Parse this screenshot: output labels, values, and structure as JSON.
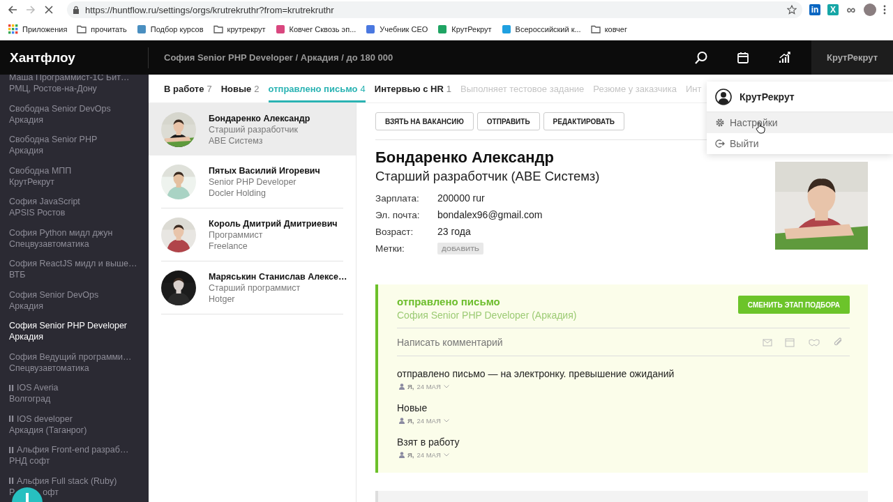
{
  "browser": {
    "url": "https://huntflow.ru/settings/orgs/krutrekruthr?from=krutrekruthr",
    "extensions": [
      {
        "kind": "linkedin",
        "glyph": "in"
      },
      {
        "kind": "x",
        "glyph": "X"
      },
      {
        "kind": "infinity",
        "glyph": "∞"
      },
      {
        "kind": "avatar"
      }
    ],
    "bookmarks": [
      {
        "kind": "apps",
        "label": "Приложения"
      },
      {
        "kind": "folder",
        "label": "прочитать"
      },
      {
        "kind": "site",
        "label": "Подбор курсов",
        "color": "#4a8fc0"
      },
      {
        "kind": "folder",
        "label": "крутрекрут"
      },
      {
        "kind": "site",
        "label": "Ковчег Сквозь эп...",
        "color": "#d9477f"
      },
      {
        "kind": "site",
        "label": "Учебник CEO",
        "color": "#4a78e0"
      },
      {
        "kind": "site",
        "label": "КрутРекрут",
        "color": "#1fa463"
      },
      {
        "kind": "site",
        "label": "Всероссийский к...",
        "color": "#1fa0e0"
      },
      {
        "kind": "folder",
        "label": "ковчег"
      }
    ]
  },
  "header": {
    "logo": "Хантфлоу",
    "breadcrumb": "София Senior PHP Developer / Аркадия / до 180 000",
    "account": "КрутРекрут"
  },
  "sidebar": {
    "items": [
      {
        "title": "Маша Программист-1С Бит…",
        "sub": "РМЦ, Ростов-на-Дону",
        "selected": false,
        "paused": false
      },
      {
        "title": "Свободна Senior DevOps",
        "sub": "Аркадия",
        "selected": false,
        "paused": false
      },
      {
        "title": "Свободна Senior PHP",
        "sub": "Аркадия",
        "selected": false,
        "paused": false
      },
      {
        "title": "Свободна МПП",
        "sub": "КрутРекрут",
        "selected": false,
        "paused": false
      },
      {
        "title": "София JavaScript",
        "sub": "APSIS Ростов",
        "selected": false,
        "paused": false
      },
      {
        "title": "София Python мидл джун",
        "sub": "Спецвузавтоматика",
        "selected": false,
        "paused": false
      },
      {
        "title": "София ReactJS мидл и выше…",
        "sub": "ВТБ",
        "selected": false,
        "paused": false
      },
      {
        "title": "София Senior DevOps",
        "sub": "Аркадия",
        "selected": false,
        "paused": false
      },
      {
        "title": "София Senior PHP Developer",
        "sub": "Аркадия",
        "selected": true,
        "paused": false
      },
      {
        "title": "София Ведущий программи…",
        "sub": "Спецвузавтоматика",
        "selected": false,
        "paused": false
      },
      {
        "title": "IOS Averia",
        "sub": "Волгоград",
        "selected": false,
        "paused": true
      },
      {
        "title": "IOS developer",
        "sub": "Аркадия (Таганрог)",
        "selected": false,
        "paused": true
      },
      {
        "title": "Альфия Front-end разраб…",
        "sub": "РНД софт",
        "selected": false,
        "paused": true
      },
      {
        "title": "Альфия Full stack (Ruby)",
        "sub_parts": [
          "Р",
          "офт"
        ],
        "selected": false,
        "paused": true
      }
    ]
  },
  "tabs": [
    {
      "label": "В работе",
      "count": "7",
      "selected": false,
      "muted": false
    },
    {
      "label": "Новые",
      "count": "2",
      "selected": false,
      "muted": false
    },
    {
      "label": "отправлено письмо",
      "count": "4",
      "selected": true,
      "muted": false
    },
    {
      "label": "Интервью с HR",
      "count": "1",
      "selected": false,
      "muted": false
    },
    {
      "label": "Выполняет тестовое задание",
      "selected": false,
      "muted": true
    },
    {
      "label": "Резюме у заказчика",
      "selected": false,
      "muted": true
    },
    {
      "label": "Инт",
      "selected": false,
      "muted": true
    }
  ],
  "account_menu": {
    "title": "КрутРекрут",
    "items": [
      {
        "kind": "settings",
        "label": "Настройки",
        "selected": true
      },
      {
        "kind": "logout",
        "label": "Выйти",
        "selected": false
      }
    ]
  },
  "candidates": [
    {
      "name": "Бондаренко Александр",
      "position": "Старший разработчик",
      "company": "ABE Системз",
      "selected": true
    },
    {
      "name": "Пятых Василий Игоревич",
      "position": "Senior PHP Developer",
      "company": "Docler Holding",
      "selected": false
    },
    {
      "name": "Король Дмитрий Дмитриевич",
      "position": "Программист",
      "company": "Freelance",
      "selected": false
    },
    {
      "name": "Маряськин Станислав Алексе…",
      "position": "Старший программист",
      "company": "Hotger",
      "selected": false
    }
  ],
  "profile": {
    "buttons": [
      "ВЗЯТЬ НА ВАКАНСИЮ",
      "ОТПРАВИТЬ",
      "РЕДАКТИРОВАТЬ"
    ],
    "name": "Бондаренко Александр",
    "title": "Старший разработчик (ABE Системз)",
    "fields": [
      {
        "label": "Зарплата:",
        "value": "200000 rur",
        "kind": "text"
      },
      {
        "label": "Эл. почта:",
        "value": "bondalex96@gmail.com",
        "kind": "text"
      },
      {
        "label": "Возраст:",
        "value": "23 года",
        "kind": "text"
      },
      {
        "label": "Метки:",
        "value": "ДОБАВИТЬ",
        "kind": "button"
      }
    ]
  },
  "stage": {
    "title": "отправлено письмо",
    "vacancy": "София Senior PHP Developer (Аркадия)",
    "button": "СМЕНИТЬ ЭТАП ПОДБОРА",
    "comment": {
      "placeholder": "Написать комментарий"
    },
    "log": [
      {
        "text": "отправлено письмо — на электронку. превышение ожиданий",
        "author": "Я,",
        "date": "24 МАЯ"
      },
      {
        "text": "Новые",
        "author": "Я,",
        "date": "24 МАЯ"
      },
      {
        "text": "Взят в работу",
        "author": "Я,",
        "date": "24 МАЯ"
      }
    ]
  }
}
